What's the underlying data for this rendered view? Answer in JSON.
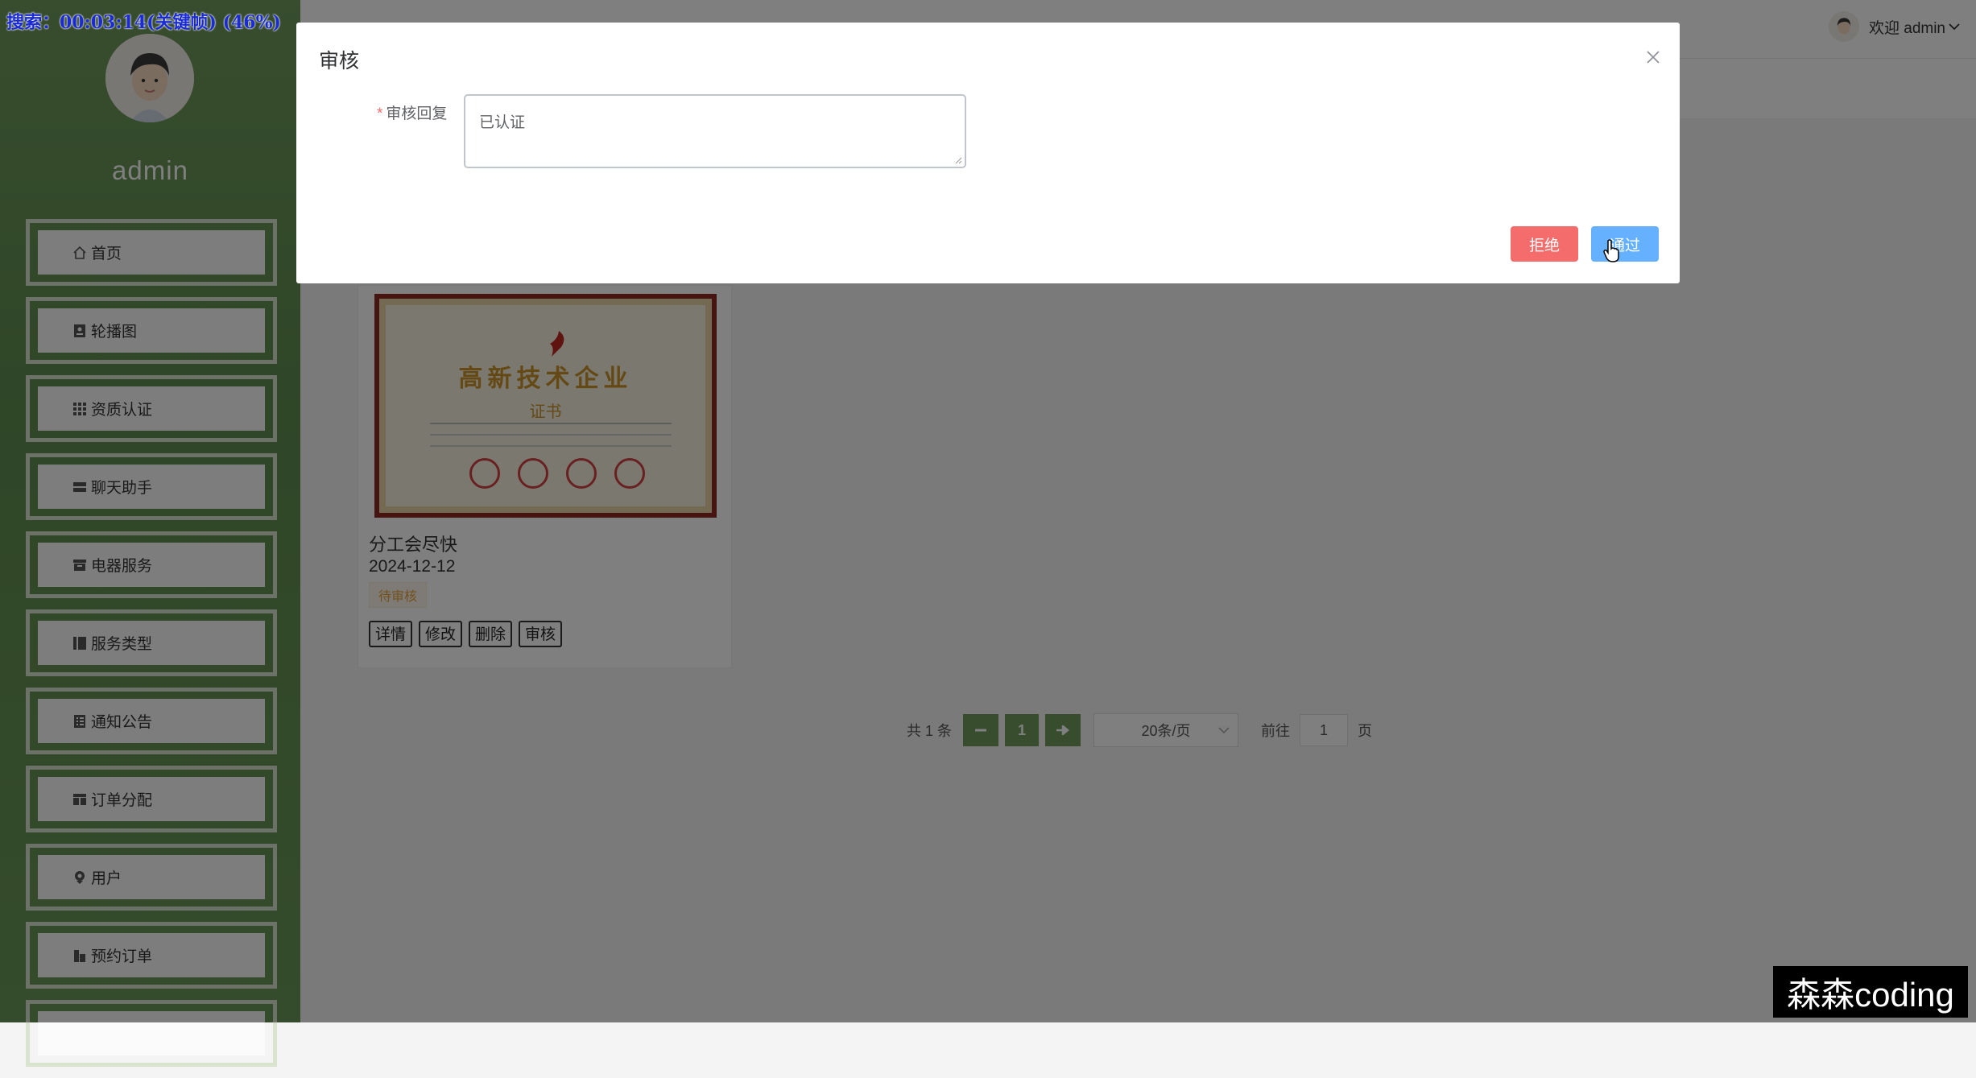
{
  "sidebar": {
    "username": "admin",
    "items": [
      {
        "label": "首页",
        "icon": "home-icon"
      },
      {
        "label": "轮播图",
        "icon": "image-icon"
      },
      {
        "label": "资质认证",
        "icon": "grid-icon"
      },
      {
        "label": "聊天助手",
        "icon": "chat-icon"
      },
      {
        "label": "电器服务",
        "icon": "box-icon"
      },
      {
        "label": "服务类型",
        "icon": "list-icon"
      },
      {
        "label": "通知公告",
        "icon": "notice-icon"
      },
      {
        "label": "订单分配",
        "icon": "order-icon"
      },
      {
        "label": "用户",
        "icon": "user-icon"
      },
      {
        "label": "预约订单",
        "icon": "building-icon"
      }
    ]
  },
  "header": {
    "welcome": "欢迎 admin"
  },
  "card": {
    "cert_title": "高新技术企业",
    "cert_subtitle": "证书",
    "title": "分工会尽快",
    "date": "2024-12-12",
    "status": "待审核",
    "actions": [
      "详情",
      "修改",
      "删除",
      "审核"
    ]
  },
  "pagination": {
    "total": "共 1 条",
    "current_page": "1",
    "page_size": "20条/页",
    "goto_label": "前往",
    "goto_value": "1",
    "page_unit": "页"
  },
  "dialog": {
    "title": "审核",
    "field_label": "审核回复",
    "field_value": "已认证",
    "reject_label": "拒绝",
    "pass_label": "通过"
  },
  "overlay": {
    "recording_status": "搜索：00:03:14(关键帧) (46%)",
    "watermark": "森森coding"
  },
  "colors": {
    "sidebar_green": "#6e9a5c",
    "reject_red": "#f56c6c",
    "pass_blue": "#66b1ff",
    "pending_orange": "#e6a23c"
  }
}
